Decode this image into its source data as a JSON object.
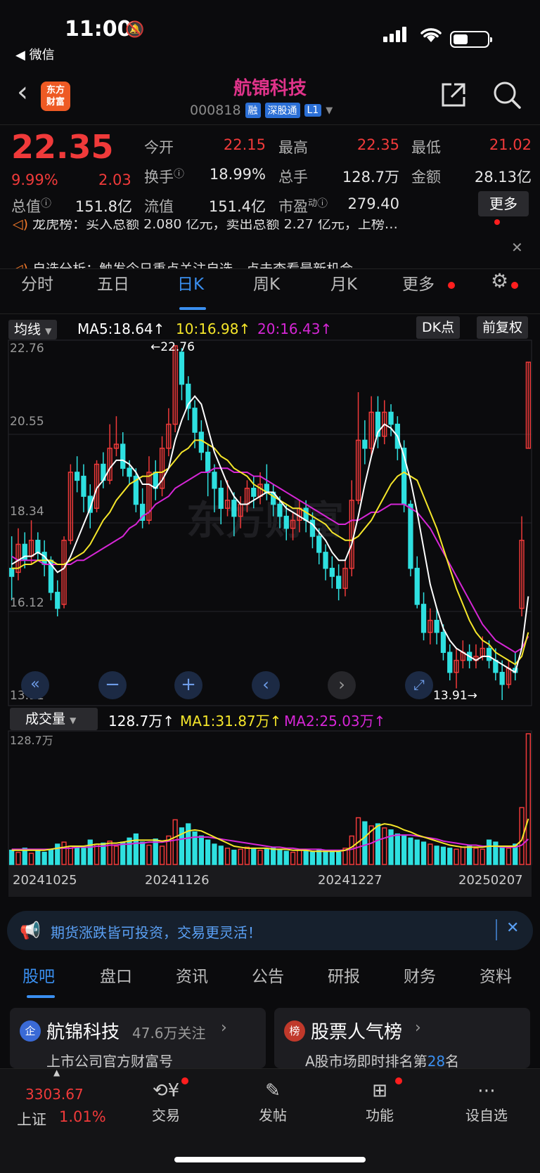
{
  "status_bar": {
    "time": "11:00",
    "back_app": "◀ 微信"
  },
  "header": {
    "logo_line1": "东方",
    "logo_line2": "财富",
    "title": "航锦科技",
    "code": "000818",
    "badges": [
      "融",
      "深股通",
      "L1"
    ]
  },
  "quote": {
    "price": "22.35",
    "change_pct": "9.99%",
    "change": "2.03",
    "open_label": "今开",
    "open": "22.15",
    "high_label": "最高",
    "high": "22.35",
    "low_label": "最低",
    "low": "21.02",
    "turnover_label": "换手",
    "turnover": "18.99%",
    "volume_label": "总手",
    "volume": "128.7万",
    "amount_label": "金额",
    "amount": "28.13亿",
    "total_mv_label": "总值",
    "total_mv": "151.8亿",
    "float_mv_label": "流值",
    "float_mv": "151.4亿",
    "pe_label": "市盈",
    "pe_sup": "动",
    "pe": "279.40",
    "more_button": "更多"
  },
  "tickers": [
    "龙虎榜：买入总额 2.080 亿元，卖出总额 2.27 亿元，上榜…",
    "自选分析：触发今日重点关注自选，点击查看最新机会"
  ],
  "period_tabs": [
    "分时",
    "五日",
    "日K",
    "周K",
    "月K",
    "更多"
  ],
  "active_tab": "日K",
  "ma_bar": {
    "selector": "均线",
    "ma5": "MA5:18.64↑",
    "ma10": "10:16.98↑",
    "ma20": "20:16.43↑",
    "dk_button": "DK点",
    "adjust_button": "前复权"
  },
  "price_axis": [
    "22.76",
    "20.55",
    "18.34",
    "16.12",
    "13.91"
  ],
  "max_annotation": "22.76",
  "min_annotation": "13.91",
  "watermark": "东方财富",
  "volume_bar": {
    "selector": "成交量",
    "vol": "128.7万↑",
    "ma1": "MA1:31.87万↑",
    "ma2": "MA2:25.03万↑",
    "axis_max": "128.7万"
  },
  "date_axis": [
    "20241025",
    "20241126",
    "20241227",
    "20250207"
  ],
  "colors": {
    "up": "#f03a3a",
    "down": "#2ee0e0",
    "ma5": "#ffffff",
    "ma10": "#f5e62a",
    "ma20": "#d626d6",
    "accent": "#3a8ff0"
  },
  "chart_data": {
    "type": "candlestick",
    "ylim": [
      13.91,
      22.76
    ],
    "candles": [
      [
        17.2,
        17.0,
        18.0,
        16.4
      ],
      [
        17.1,
        17.8,
        18.2,
        16.9
      ],
      [
        17.8,
        17.4,
        18.1,
        17.2
      ],
      [
        17.5,
        17.9,
        18.4,
        17.3
      ],
      [
        17.9,
        17.6,
        18.1,
        17.4
      ],
      [
        17.6,
        17.3,
        17.9,
        17.0
      ],
      [
        17.4,
        16.6,
        17.5,
        16.4
      ],
      [
        16.6,
        16.2,
        16.9,
        16.0
      ],
      [
        16.3,
        17.9,
        18.0,
        16.2
      ],
      [
        17.9,
        19.6,
        19.8,
        17.8
      ],
      [
        19.6,
        19.4,
        20.0,
        19.1
      ],
      [
        19.5,
        19.0,
        19.8,
        18.6
      ],
      [
        19.0,
        18.6,
        19.3,
        18.2
      ],
      [
        18.7,
        19.8,
        19.9,
        18.6
      ],
      [
        19.8,
        19.4,
        20.1,
        19.2
      ],
      [
        19.4,
        20.2,
        20.8,
        19.3
      ],
      [
        20.2,
        20.3,
        21.0,
        20.0
      ],
      [
        20.3,
        19.7,
        20.6,
        19.5
      ],
      [
        19.7,
        19.5,
        19.9,
        19.3
      ],
      [
        19.5,
        18.8,
        19.7,
        18.6
      ],
      [
        18.8,
        18.4,
        19.2,
        18.2
      ],
      [
        18.4,
        19.6,
        20.0,
        18.3
      ],
      [
        19.6,
        19.2,
        19.9,
        18.9
      ],
      [
        19.2,
        20.2,
        20.5,
        19.0
      ],
      [
        20.2,
        20.8,
        21.2,
        20.0
      ],
      [
        20.8,
        22.76,
        22.76,
        20.6
      ],
      [
        22.6,
        21.8,
        22.7,
        21.4
      ],
      [
        21.8,
        21.2,
        22.0,
        20.9
      ],
      [
        21.2,
        20.6,
        21.4,
        20.2
      ],
      [
        20.6,
        20.1,
        20.9,
        19.9
      ],
      [
        20.1,
        19.6,
        20.3,
        19.0
      ],
      [
        19.6,
        19.2,
        19.8,
        18.6
      ],
      [
        19.2,
        18.7,
        19.4,
        18.3
      ],
      [
        18.7,
        18.9,
        19.4,
        18.5
      ],
      [
        18.9,
        18.5,
        19.1,
        18.0
      ],
      [
        18.5,
        18.8,
        19.0,
        18.2
      ],
      [
        18.8,
        19.2,
        19.4,
        18.6
      ],
      [
        19.2,
        19.0,
        19.5,
        18.7
      ],
      [
        19.0,
        19.3,
        19.6,
        18.8
      ],
      [
        19.3,
        19.1,
        19.8,
        18.9
      ],
      [
        19.1,
        18.8,
        19.3,
        18.5
      ],
      [
        18.8,
        18.5,
        19.0,
        18.2
      ],
      [
        18.5,
        18.2,
        18.8,
        17.9
      ],
      [
        18.2,
        18.4,
        18.6,
        17.9
      ],
      [
        18.4,
        18.7,
        18.9,
        18.1
      ],
      [
        18.7,
        18.4,
        18.9,
        18.1
      ],
      [
        18.4,
        18.0,
        18.6,
        17.7
      ],
      [
        18.0,
        17.6,
        18.2,
        17.3
      ],
      [
        17.6,
        17.2,
        17.8,
        16.9
      ],
      [
        17.2,
        17.0,
        17.5,
        16.7
      ],
      [
        17.0,
        16.7,
        17.3,
        16.4
      ],
      [
        16.7,
        17.2,
        17.4,
        16.5
      ],
      [
        17.2,
        18.9,
        19.4,
        17.0
      ],
      [
        18.9,
        20.4,
        21.6,
        18.8
      ],
      [
        20.4,
        20.2,
        20.9,
        19.8
      ],
      [
        20.2,
        21.1,
        21.5,
        20.0
      ],
      [
        21.1,
        20.5,
        21.5,
        20.2
      ],
      [
        20.5,
        21.1,
        21.4,
        20.3
      ],
      [
        21.1,
        20.8,
        21.3,
        20.5
      ],
      [
        20.8,
        20.2,
        21.0,
        19.9
      ],
      [
        20.2,
        18.8,
        20.4,
        18.6
      ],
      [
        18.8,
        17.2,
        18.9,
        17.0
      ],
      [
        17.2,
        16.3,
        17.5,
        16.2
      ],
      [
        16.3,
        15.6,
        16.6,
        15.4
      ],
      [
        15.6,
        15.9,
        16.2,
        15.3
      ],
      [
        15.9,
        15.6,
        16.2,
        15.3
      ],
      [
        15.6,
        15.1,
        15.8,
        14.9
      ],
      [
        15.1,
        14.6,
        15.3,
        14.4
      ],
      [
        14.6,
        14.9,
        15.2,
        14.2
      ],
      [
        14.9,
        15.1,
        15.4,
        14.7
      ],
      [
        15.1,
        14.9,
        15.3,
        14.7
      ],
      [
        14.9,
        15.0,
        15.3,
        14.7
      ],
      [
        15.0,
        15.2,
        15.5,
        14.9
      ],
      [
        15.2,
        14.9,
        15.4,
        14.7
      ],
      [
        14.9,
        14.6,
        15.2,
        14.4
      ],
      [
        14.6,
        14.3,
        14.9,
        13.91
      ],
      [
        14.3,
        14.7,
        14.9,
        14.2
      ],
      [
        14.7,
        14.6,
        15.1,
        14.4
      ],
      [
        16.2,
        17.9,
        18.5,
        16.0
      ],
      [
        20.2,
        22.35,
        22.35,
        20.2
      ]
    ],
    "ma5": [
      17.3,
      17.4,
      17.5,
      17.5,
      17.6,
      17.5,
      17.3,
      17.1,
      17.2,
      17.5,
      17.9,
      18.3,
      18.7,
      19.2,
      19.4,
      19.7,
      19.9,
      19.9,
      19.8,
      19.6,
      19.3,
      19.3,
      19.2,
      19.4,
      19.7,
      20.4,
      20.9,
      21.3,
      21.5,
      21.3,
      20.7,
      20.1,
      19.7,
      19.3,
      19.0,
      18.8,
      18.8,
      18.9,
      19.0,
      19.1,
      19.1,
      18.9,
      18.7,
      18.6,
      18.5,
      18.4,
      18.3,
      18.1,
      17.9,
      17.6,
      17.4,
      17.4,
      17.8,
      18.5,
      19.3,
      20.0,
      20.6,
      20.8,
      20.7,
      20.5,
      20.0,
      19.4,
      18.6,
      17.7,
      16.8,
      16.2,
      15.7,
      15.4,
      15.2,
      15.1,
      15.0,
      14.9,
      15.0,
      15.0,
      14.9,
      14.8,
      14.7,
      14.6,
      15.2,
      16.5
    ],
    "ma10": [
      17.2,
      17.2,
      17.3,
      17.3,
      17.4,
      17.4,
      17.4,
      17.3,
      17.3,
      17.4,
      17.5,
      17.6,
      17.8,
      18.1,
      18.4,
      18.6,
      18.9,
      19.1,
      19.3,
      19.4,
      19.5,
      19.5,
      19.6,
      19.6,
      19.7,
      19.9,
      20.1,
      20.2,
      20.4,
      20.4,
      20.3,
      20.2,
      20.0,
      19.9,
      19.7,
      19.6,
      19.5,
      19.3,
      19.2,
      19.1,
      19.0,
      18.9,
      18.8,
      18.7,
      18.7,
      18.6,
      18.5,
      18.4,
      18.3,
      18.1,
      18.0,
      17.9,
      17.9,
      18.0,
      18.2,
      18.4,
      18.7,
      19.0,
      19.3,
      19.5,
      19.6,
      19.5,
      19.4,
      19.0,
      18.6,
      18.2,
      17.7,
      17.2,
      16.7,
      16.3,
      15.9,
      15.6,
      15.4,
      15.3,
      15.1,
      15.0,
      14.9,
      14.8,
      15.0,
      15.6
    ],
    "ma20": [
      17.5,
      17.4,
      17.4,
      17.4,
      17.4,
      17.3,
      17.3,
      17.3,
      17.3,
      17.3,
      17.4,
      17.4,
      17.5,
      17.6,
      17.7,
      17.8,
      17.9,
      18.0,
      18.2,
      18.3,
      18.5,
      18.6,
      18.8,
      18.9,
      19.0,
      19.2,
      19.3,
      19.4,
      19.5,
      19.6,
      19.6,
      19.7,
      19.7,
      19.7,
      19.6,
      19.6,
      19.6,
      19.5,
      19.5,
      19.4,
      19.3,
      19.2,
      19.1,
      19.0,
      18.9,
      18.8,
      18.7,
      18.6,
      18.5,
      18.4,
      18.3,
      18.3,
      18.4,
      18.4,
      18.5,
      18.6,
      18.6,
      18.7,
      18.8,
      18.8,
      18.8,
      18.7,
      18.6,
      18.4,
      18.2,
      17.9,
      17.6,
      17.3,
      17.0,
      16.7,
      16.4,
      16.1,
      15.8,
      15.6,
      15.4,
      15.3,
      15.2,
      15.1,
      15.2,
      15.5
    ],
    "volume": [
      14,
      12,
      16,
      11,
      13,
      12,
      15,
      20,
      22,
      18,
      17,
      16,
      24,
      20,
      21,
      23,
      18,
      22,
      26,
      30,
      22,
      19,
      25,
      18,
      28,
      44,
      36,
      40,
      32,
      28,
      24,
      20,
      18,
      16,
      14,
      15,
      17,
      16,
      14,
      15,
      16,
      14,
      13,
      12,
      14,
      13,
      12,
      15,
      14,
      13,
      12,
      16,
      28,
      46,
      42,
      38,
      40,
      36,
      34,
      30,
      28,
      26,
      24,
      22,
      20,
      18,
      17,
      16,
      15,
      17,
      18,
      16,
      15,
      24,
      22,
      18,
      16,
      20,
      56,
      128.7
    ],
    "vol_ma1": [
      14,
      14,
      14,
      14,
      14,
      14,
      15,
      16,
      17,
      18,
      18,
      18,
      19,
      20,
      20,
      21,
      21,
      22,
      23,
      24,
      24,
      24,
      24,
      23,
      24,
      27,
      30,
      33,
      34,
      33,
      30,
      27,
      24,
      21,
      18,
      17,
      16,
      16,
      16,
      16,
      15,
      15,
      15,
      14,
      14,
      14,
      13,
      13,
      13,
      13,
      13,
      14,
      17,
      22,
      27,
      33,
      38,
      40,
      39,
      37,
      34,
      32,
      29,
      27,
      25,
      23,
      21,
      19,
      18,
      17,
      17,
      17,
      17,
      18,
      18,
      18,
      18,
      18,
      24,
      45
    ],
    "vol_ma2": [
      15,
      15,
      15,
      15,
      15,
      15,
      15,
      16,
      16,
      16,
      17,
      17,
      17,
      18,
      18,
      19,
      19,
      20,
      20,
      21,
      21,
      22,
      22,
      22,
      23,
      24,
      25,
      26,
      27,
      27,
      27,
      26,
      25,
      24,
      23,
      22,
      21,
      20,
      19,
      18,
      17,
      17,
      16,
      16,
      15,
      15,
      15,
      15,
      14,
      14,
      14,
      14,
      15,
      17,
      19,
      21,
      24,
      26,
      28,
      29,
      29,
      29,
      28,
      27,
      26,
      25,
      23,
      22,
      21,
      20,
      19,
      19,
      18,
      18,
      18,
      17,
      17,
      17,
      19,
      25
    ]
  },
  "promo_banner": "期货涨跌皆可投资，交易更灵活！",
  "section_tabs": [
    "股吧",
    "盘口",
    "资讯",
    "公告",
    "研报",
    "财务",
    "资料"
  ],
  "active_section": "股吧",
  "cards": [
    {
      "badge": "企",
      "title": "航锦科技",
      "meta": "47.6万关注",
      "subtitle": "上市公司官方财富号"
    },
    {
      "badge": "榜",
      "title": "股票人气榜",
      "subtitle_prefix": "A股市场即时排名第",
      "rank": "28",
      "subtitle_suffix": "名"
    }
  ],
  "bottom_nav": {
    "index_value": "3303.67",
    "index_name": "上证",
    "index_change": "1.01%",
    "items": [
      "交易",
      "发帖",
      "功能",
      "设自选"
    ]
  }
}
